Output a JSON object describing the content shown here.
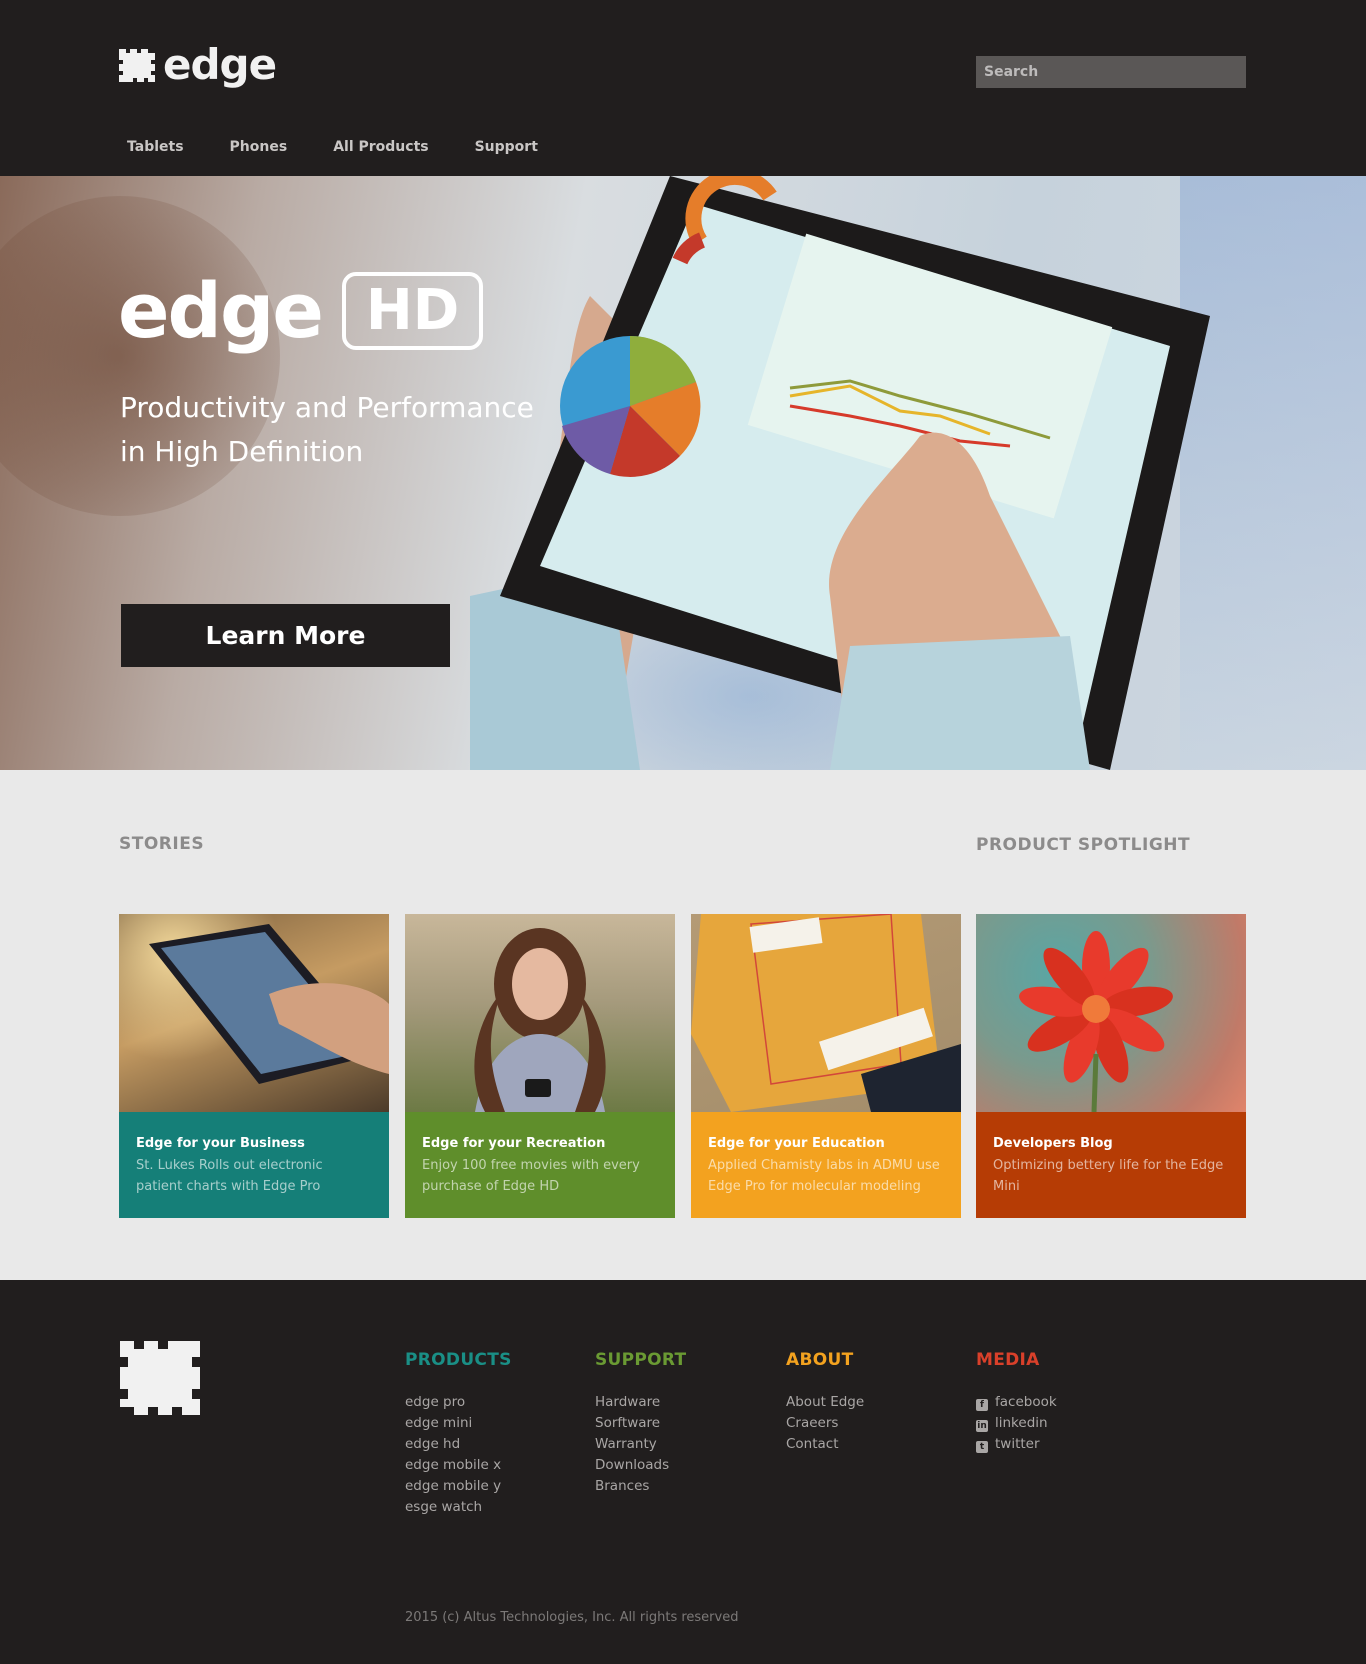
{
  "header": {
    "logo_text": "edge",
    "search_placeholder": "Search",
    "nav": [
      "Tablets",
      "Phones",
      "All Products",
      "Support"
    ]
  },
  "hero": {
    "brand": "edge",
    "badge": "HD",
    "subtitle_line1": "Productivity and Performance",
    "subtitle_line2": "in High Definition",
    "cta_label": "Learn More"
  },
  "stories": {
    "section_title": "STORIES",
    "spotlight_title": "PRODUCT SPOTLIGHT",
    "cards": [
      {
        "title": "Edge for your Business",
        "text": "St. Lukes Rolls out electronic patient charts with Edge Pro",
        "color": "#157f78"
      },
      {
        "title": "Edge for your Recreation",
        "text": "Enjoy 100 free movies with every purchase of Edge HD",
        "color": "#5f8e2b"
      },
      {
        "title": "Edge for your Education",
        "text": "Applied Chamisty labs in ADMU use Edge Pro for molecular modeling",
        "color": "#f3a21f"
      },
      {
        "title": "Developers Blog",
        "text": "Optimizing bettery life for the Edge Mini",
        "color": "#b63c05"
      }
    ]
  },
  "footer": {
    "columns": [
      {
        "title": "PRODUCTS",
        "color": "#1a8f86",
        "items": [
          "edge pro",
          "edge mini",
          "edge hd",
          "edge mobile x",
          "edge mobile y",
          "esge watch"
        ]
      },
      {
        "title": "SUPPORT",
        "color": "#6a9a33",
        "items": [
          "Hardware",
          "Sorftware",
          "Warranty",
          "Downloads",
          "Brances"
        ]
      },
      {
        "title": "ABOUT",
        "color": "#f3a21f",
        "items": [
          "About Edge",
          "Craeers",
          "Contact"
        ]
      },
      {
        "title": "MEDIA",
        "color": "#d9402a",
        "items": [
          "facebook",
          "linkedin",
          "twitter"
        ]
      }
    ],
    "copyright": "2015 (c) Altus Technologies, Inc. All rights reserved"
  }
}
